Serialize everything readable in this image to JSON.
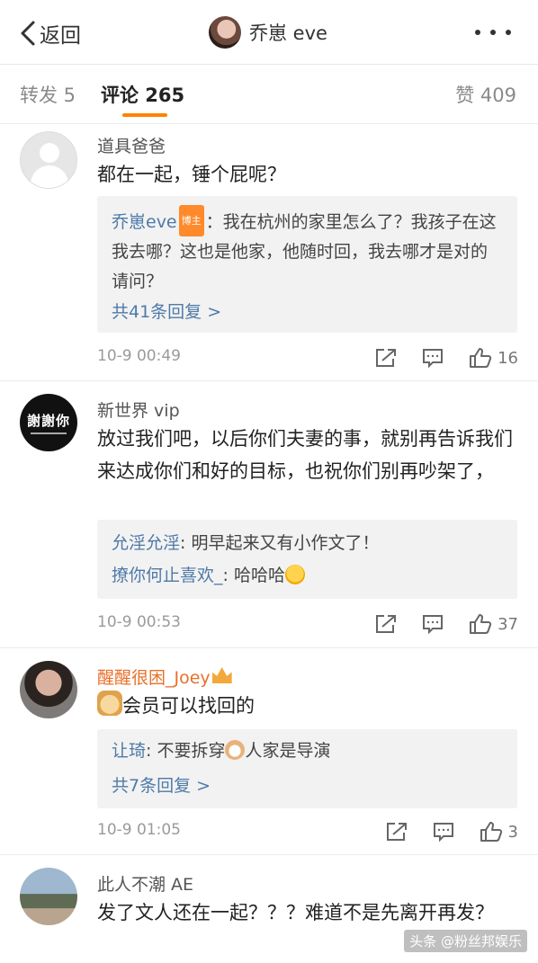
{
  "header": {
    "back_label": "返回",
    "user_name": "乔崽 eve"
  },
  "tabs": {
    "repost": "转发 5",
    "comments": "评论 265",
    "likes": "赞 409"
  },
  "comments": [
    {
      "name": "道具爸爸",
      "text": "都在一起，锤个屁呢？",
      "reply": {
        "author": "乔崽eve",
        "badge": "博主",
        "content": "：我在杭州的家里怎么了？我孩子在这我去哪？这也是他家，他随时回，我去哪才是对的请问？",
        "more": "共41条回复 >"
      },
      "time": "10-9 00:49",
      "like_count": "16"
    },
    {
      "name": "新世界 vip",
      "avatar_text": "謝謝你",
      "text": "放过我们吧，以后你们夫妻的事，就别再告诉我们来达成你们和好的目标，也祝你们别再吵架了，",
      "replies": [
        {
          "author": "允淫允淫",
          "content": ": 明早起来又有小作文了！"
        },
        {
          "author": "撩你何止喜欢_",
          "content": ": 哈哈哈"
        }
      ],
      "time": "10-9 00:53",
      "like_count": "37"
    },
    {
      "name": "醒醒很困_Joey",
      "text": "会员可以找回的",
      "reply": {
        "author": "让琦",
        "content_a": ": 不要拆穿",
        "content_b": "人家是导演",
        "more": "共7条回复 >"
      },
      "time": "10-9 01:05",
      "like_count": "3"
    },
    {
      "name": "此人不潮 AE",
      "text": "发了文人还在一起？？？难道不是先离开再发？"
    }
  ],
  "watermark": "头条 @粉丝邦娱乐"
}
